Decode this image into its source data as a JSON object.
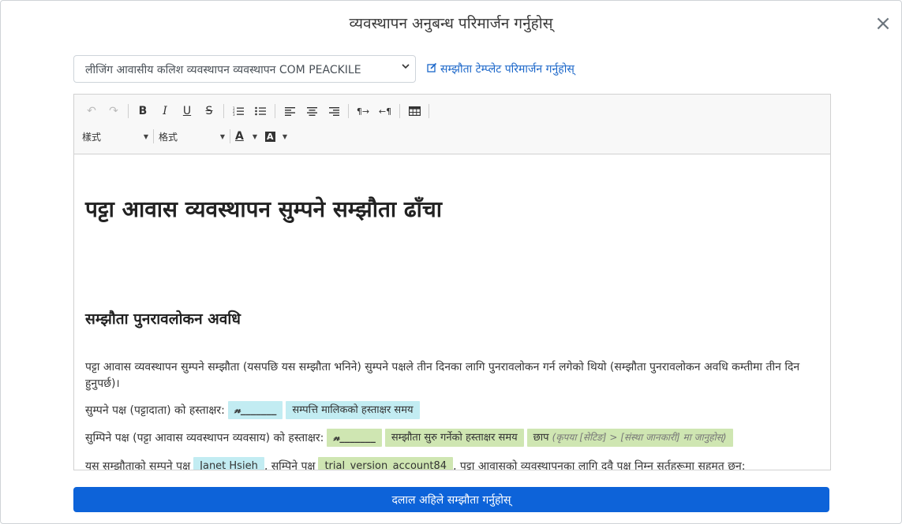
{
  "modal": {
    "title": "व्यवस्थापन अनुबन्ध परिमार्जन गर्नुहोस्",
    "close_label": "×"
  },
  "template_select": {
    "selected": "लीजिंग आवासीय कलिश व्यवस्थापन व्यवस्थापन COM PEACKILE"
  },
  "edit_template_link": {
    "label": "सम्झौता टेम्प्लेट परिमार्जन गर्नुहोस्"
  },
  "toolbar": {
    "undo_icon": "↶",
    "redo_icon": "↷",
    "bold": "B",
    "italic": "I",
    "underline": "U",
    "strike": "S",
    "ol_icon": "≡",
    "ul_icon": "≔",
    "align_left_icon": "≡",
    "align_center_icon": "≡",
    "align_right_icon": "≡",
    "ltr_icon": "¶→",
    "rtl_icon": "←¶",
    "table_icon": "⊞",
    "style_label": "樣式",
    "format_label": "格式",
    "text_color_label": "A",
    "bg_color_label": "A"
  },
  "document": {
    "heading": "पट्टा आवास व्यवस्थापन सुम्पने सम्झौता ढाँचा",
    "section_heading": "सम्झौता पुनरावलोकन अवधि",
    "paragraph": "पट्टा आवास व्यवस्थापन सुम्पने सम्झौता (यसपछि यस सम्झौता भनिने) सुम्पने पक्षले तीन दिनका लागि पुनरावलोकन गर्न लगेको थियो (सम्झौता पुनरावलोकन अवधि कम्तीमा तीन दिन हुनुपर्छ)।",
    "line1": {
      "label": "सुम्पने पक्ष (पट्टादाता) को हस्ताक्षर:",
      "signature": "𝓃_______",
      "time_chip": "सम्पत्ति मालिकको हस्ताक्षर समय"
    },
    "line2": {
      "label": "सुम्पिने पक्ष (पट्टा आवास व्यवस्थापन व्यवसाय) को हस्ताक्षर:",
      "signature": "𝓃_______",
      "time_chip": "सम्झौता सुरु गर्नेको हस्ताक्षर समय",
      "stamp_label": "छाप",
      "stamp_hint": "(कृपया [सेटिङ] > [संस्था जानकारी] मा जानुहोस्)"
    },
    "line3": {
      "prefix": "यस सम्झौताको सम्पने पक्ष",
      "party1": "Janet Hsieh",
      "middle": ", सम्पिने पक्ष",
      "party2": "trial_version_account84",
      "suffix": ", पट्टा आवासको व्यवस्थापनका लागि दवै पक्ष निम्न सर्तहरूमा सहमत छन्:"
    }
  },
  "submit_button": {
    "label": "दलाल अहिले सम्झौता गर्नुहोस्"
  },
  "colors": {
    "primary": "#0d63d9",
    "link": "#1a66c9",
    "chip_blue": "#c2ecf2",
    "chip_green": "#cfe6b2"
  }
}
